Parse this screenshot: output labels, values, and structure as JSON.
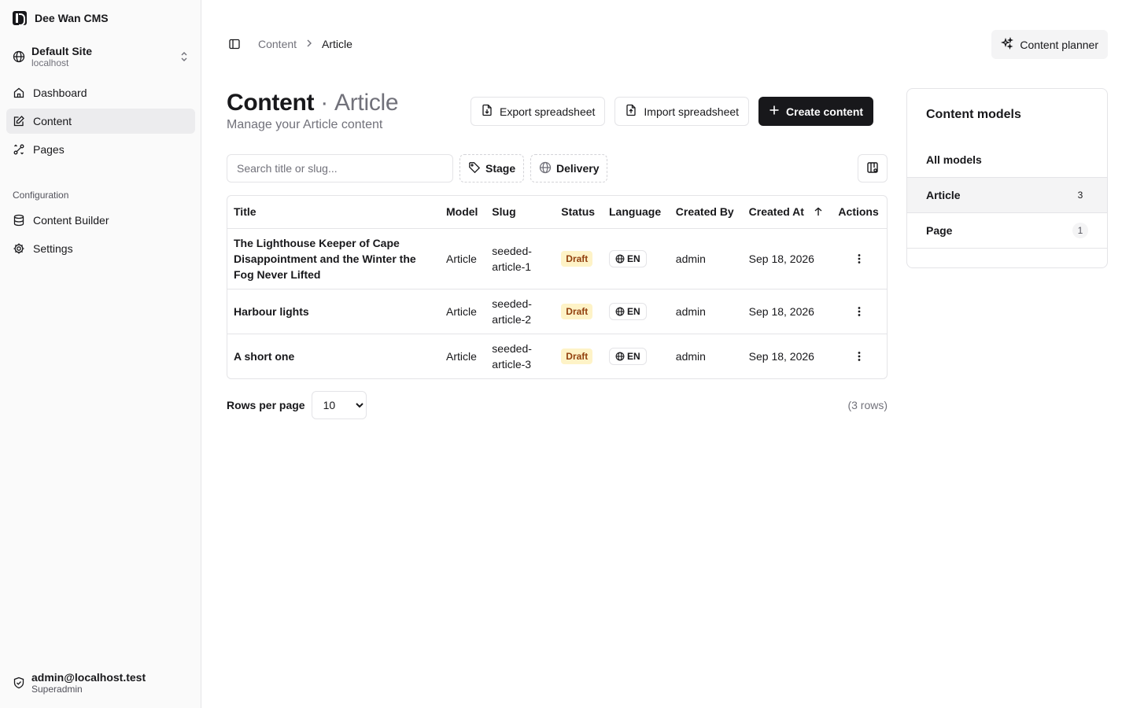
{
  "app": {
    "name": "Dee Wan CMS"
  },
  "site": {
    "name": "Default Site",
    "host": "localhost"
  },
  "nav": {
    "items": [
      {
        "label": "Dashboard",
        "icon": "home-icon"
      },
      {
        "label": "Content",
        "icon": "edit-icon",
        "active": true
      },
      {
        "label": "Pages",
        "icon": "pages-icon"
      }
    ],
    "group_label": "Configuration",
    "config_items": [
      {
        "label": "Content Builder",
        "icon": "database-icon"
      },
      {
        "label": "Settings",
        "icon": "gear-icon"
      }
    ]
  },
  "user": {
    "email": "admin@localhost.test",
    "role": "Superadmin"
  },
  "breadcrumb": {
    "parent": "Content",
    "current": "Article"
  },
  "topbar": {
    "planner_label": "Content planner"
  },
  "header": {
    "title": "Content",
    "separator": "·",
    "model": "Article",
    "subtitle": "Manage your Article content"
  },
  "toolbar": {
    "export_label": "Export spreadsheet",
    "import_label": "Import spreadsheet",
    "create_label": "Create content"
  },
  "filters": {
    "search_placeholder": "Search title or slug...",
    "stage_label": "Stage",
    "delivery_label": "Delivery"
  },
  "table": {
    "columns": [
      "Title",
      "Model",
      "Slug",
      "Status",
      "Language",
      "Created By",
      "Created At",
      "Actions"
    ],
    "rows": [
      {
        "title": "The Lighthouse Keeper of Cape Disappointment and the Winter the Fog Never Lifted",
        "model": "Article",
        "slug": "seeded-article-1",
        "status": "Draft",
        "language": "EN",
        "created_by": "admin",
        "created_at": "Sep 18, 2026"
      },
      {
        "title": "Harbour lights",
        "model": "Article",
        "slug": "seeded-article-2",
        "status": "Draft",
        "language": "EN",
        "created_by": "admin",
        "created_at": "Sep 18, 2026"
      },
      {
        "title": "A short one",
        "model": "Article",
        "slug": "seeded-article-3",
        "status": "Draft",
        "language": "EN",
        "created_by": "admin",
        "created_at": "Sep 18, 2026"
      }
    ]
  },
  "pager": {
    "label": "Rows per page",
    "value": "10",
    "count": "(3 rows)"
  },
  "models_panel": {
    "title": "Content models",
    "items": [
      {
        "label": "All models",
        "count": ""
      },
      {
        "label": "Article",
        "count": "3",
        "active": true
      },
      {
        "label": "Page",
        "count": "1"
      }
    ]
  },
  "colors": {
    "accent": "#18181b",
    "draft_bg": "#fef3c7",
    "draft_fg": "#92400e",
    "active_bg": "#ececee"
  }
}
